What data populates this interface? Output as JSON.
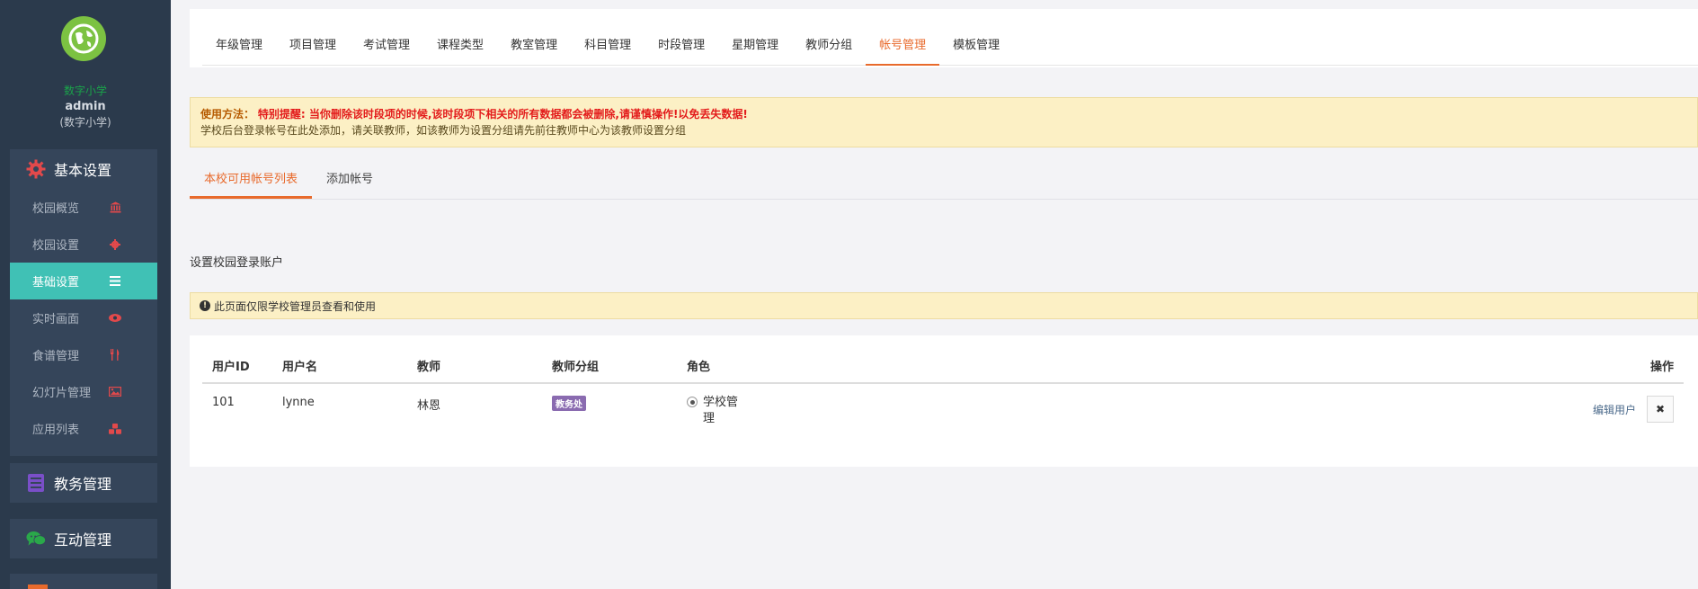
{
  "sidebar": {
    "school_name": "数字小学",
    "user_name": "admin",
    "user_sub": "(数字小学)",
    "groups": [
      {
        "label": "基本设置",
        "icon": "gear-icon",
        "icon_color": "#e2494b",
        "items": [
          {
            "label": "校园概览",
            "icon": "bank-icon"
          },
          {
            "label": "校园设置",
            "icon": "cog-icon"
          },
          {
            "label": "基础设置",
            "icon": "list-icon",
            "active": true
          },
          {
            "label": "实时画面",
            "icon": "eye-icon"
          },
          {
            "label": "食谱管理",
            "icon": "cutlery-icon"
          },
          {
            "label": "幻灯片管理",
            "icon": "picture-icon"
          },
          {
            "label": "应用列表",
            "icon": "cubes-icon"
          }
        ]
      },
      {
        "label": "教务管理",
        "icon": "book-icon",
        "icon_color": "#7a4fc8"
      },
      {
        "label": "互动管理",
        "icon": "chat-icon",
        "icon_color": "#2aa84a"
      }
    ]
  },
  "top_tabs": [
    {
      "label": "年级管理"
    },
    {
      "label": "项目管理"
    },
    {
      "label": "考试管理"
    },
    {
      "label": "课程类型"
    },
    {
      "label": "教室管理"
    },
    {
      "label": "科目管理"
    },
    {
      "label": "时段管理"
    },
    {
      "label": "星期管理"
    },
    {
      "label": "教师分组"
    },
    {
      "label": "帐号管理",
      "active": true
    },
    {
      "label": "模板管理"
    }
  ],
  "notice": {
    "label": "使用方法：",
    "warning": "特别提醒: 当你删除该时段项的时候,该时段项下相关的所有数据都会被删除,请谨慎操作!以免丢失数据!",
    "text": "学校后台登录帐号在此处添加，请关联教师，如该教师为设置分组请先前往教师中心为该教师设置分组"
  },
  "sub_tabs": [
    {
      "label": "本校可用帐号列表",
      "active": true
    },
    {
      "label": "添加帐号"
    }
  ],
  "section_title": "设置校园登录账户",
  "info_alert": "此页面仅限学校管理员查看和使用",
  "table": {
    "headers": {
      "id": "用户ID",
      "username": "用户名",
      "teacher": "教师",
      "group": "教师分组",
      "role": "角色",
      "ops": "操作"
    },
    "rows": [
      {
        "id": "101",
        "username": "lynne",
        "teacher": "林恩",
        "group": "教务处",
        "role": "学校管理",
        "edit": "编辑用户",
        "delete": "✖"
      }
    ]
  },
  "colors": {
    "accent": "#e86a2c",
    "active_nav": "#40c1b5",
    "sidebar_bg": "#2b3a4c",
    "tag_bg": "#8a6bb0"
  }
}
